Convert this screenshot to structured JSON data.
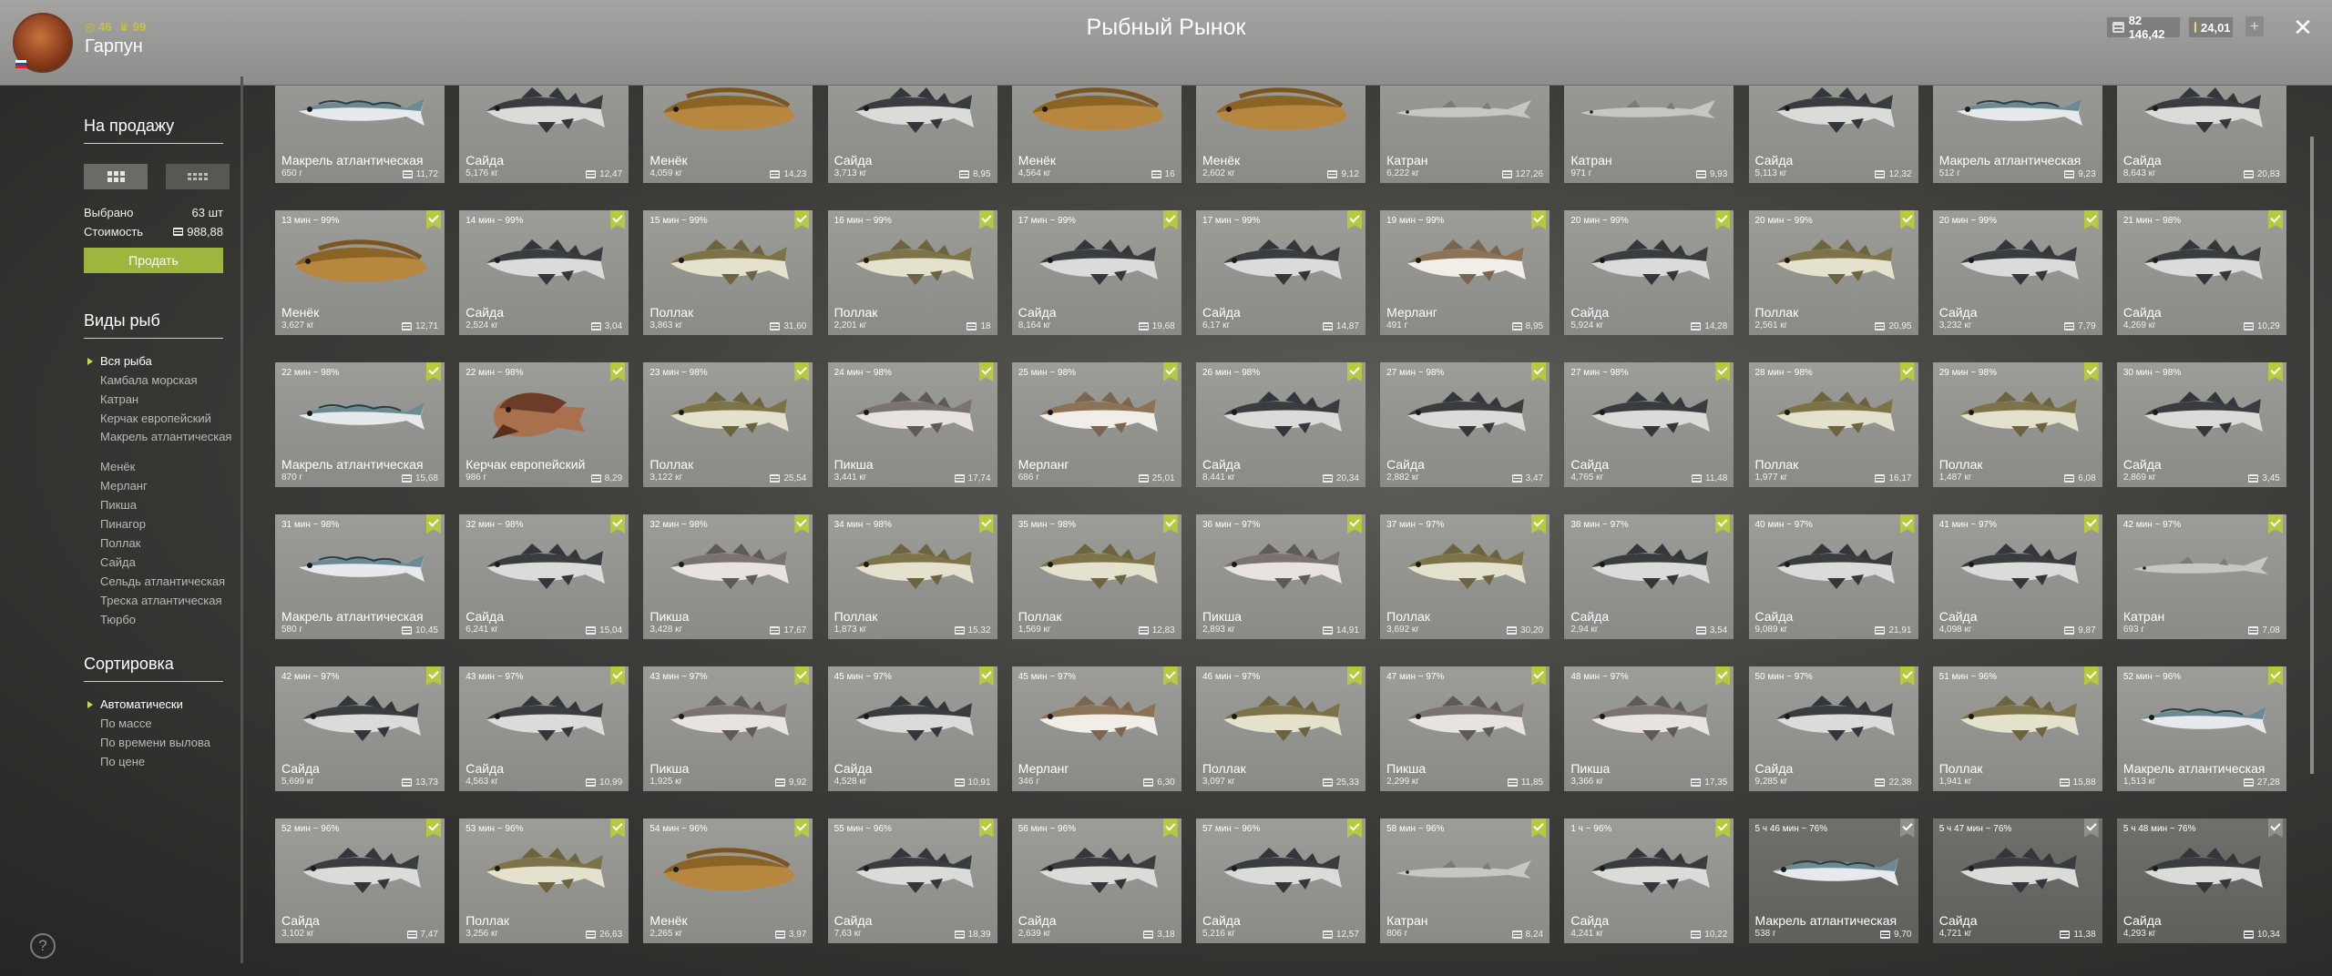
{
  "player": {
    "name": "Гарпун",
    "level": "46",
    "rating": "99"
  },
  "header": {
    "title": "Рыбный Рынок",
    "silver": "82 146,42",
    "gold": "24,01",
    "plus": "+",
    "close": "✕"
  },
  "sidebar": {
    "sale_title": "На продажу",
    "selected_label": "Выбрано",
    "selected_value": "63 шт",
    "cost_label": "Стоимость",
    "cost_value": "988,88",
    "sell_button": "Продать",
    "species_title": "Виды рыб",
    "species": [
      "Вся рыба",
      "Камбала морская",
      "Катран",
      "Керчак европейский",
      "Макрель атлантическая",
      "Менёк",
      "Мерланг",
      "Пикша",
      "Пинагор",
      "Поллак",
      "Сайда",
      "Сельдь атлантическая",
      "Треска атлантическая",
      "Тюрбо"
    ],
    "sort_title": "Сортировка",
    "sort_options": [
      "Автоматически",
      "По массе",
      "По времени вылова",
      "По цене"
    ],
    "help": "?"
  },
  "colors": {
    "accent": "#9eb63e",
    "check": "#b7c93e"
  },
  "fish": [
    {
      "time": "",
      "name": "Макрель атлантическая",
      "mass": "650 г",
      "price": "11,72",
      "kind": "mackerel"
    },
    {
      "time": "",
      "name": "Сайда",
      "mass": "5,176 кг",
      "price": "12,47",
      "kind": "saithe"
    },
    {
      "time": "",
      "name": "Менёк",
      "mass": "4,059 кг",
      "price": "14,23",
      "kind": "tusk"
    },
    {
      "time": "",
      "name": "Сайда",
      "mass": "3,713 кг",
      "price": "8,95",
      "kind": "saithe"
    },
    {
      "time": "",
      "name": "Менёк",
      "mass": "4,564 кг",
      "price": "16",
      "kind": "tusk"
    },
    {
      "time": "",
      "name": "Менёк",
      "mass": "2,602 кг",
      "price": "9,12",
      "kind": "tusk"
    },
    {
      "time": "",
      "name": "Катран",
      "mass": "6,222 кг",
      "price": "127,26",
      "kind": "shark"
    },
    {
      "time": "",
      "name": "Катран",
      "mass": "971 г",
      "price": "9,93",
      "kind": "shark"
    },
    {
      "time": "",
      "name": "Сайда",
      "mass": "5,113 кг",
      "price": "12,32",
      "kind": "saithe"
    },
    {
      "time": "",
      "name": "Макрель атлантическая",
      "mass": "512 г",
      "price": "9,23",
      "kind": "mackerel"
    },
    {
      "time": "",
      "name": "Сайда",
      "mass": "8,643 кг",
      "price": "20,83",
      "kind": "saithe"
    },
    {
      "time": "13 мин ~ 99%",
      "name": "Менёк",
      "mass": "3,627 кг",
      "price": "12,71",
      "kind": "tusk"
    },
    {
      "time": "14 мин ~ 99%",
      "name": "Сайда",
      "mass": "2,524 кг",
      "price": "3,04",
      "kind": "saithe"
    },
    {
      "time": "15 мин ~ 99%",
      "name": "Поллак",
      "mass": "3,863 кг",
      "price": "31,60",
      "kind": "pollack"
    },
    {
      "time": "16 мин ~ 99%",
      "name": "Поллак",
      "mass": "2,201 кг",
      "price": "18",
      "kind": "pollack"
    },
    {
      "time": "17 мин ~ 99%",
      "name": "Сайда",
      "mass": "8,164 кг",
      "price": "19,68",
      "kind": "saithe"
    },
    {
      "time": "17 мин ~ 99%",
      "name": "Сайда",
      "mass": "6,17 кг",
      "price": "14,87",
      "kind": "saithe"
    },
    {
      "time": "19 мин ~ 99%",
      "name": "Мерланг",
      "mass": "491 г",
      "price": "8,95",
      "kind": "whiting"
    },
    {
      "time": "20 мин ~ 99%",
      "name": "Сайда",
      "mass": "5,924 кг",
      "price": "14,28",
      "kind": "saithe"
    },
    {
      "time": "20 мин ~ 99%",
      "name": "Поллак",
      "mass": "2,561 кг",
      "price": "20,95",
      "kind": "pollack"
    },
    {
      "time": "20 мин ~ 99%",
      "name": "Сайда",
      "mass": "3,232 кг",
      "price": "7,79",
      "kind": "saithe"
    },
    {
      "time": "21 мин ~ 98%",
      "name": "Сайда",
      "mass": "4,269 кг",
      "price": "10,29",
      "kind": "saithe"
    },
    {
      "time": "22 мин ~ 98%",
      "name": "Макрель атлантическая",
      "mass": "870 г",
      "price": "15,68",
      "kind": "mackerel"
    },
    {
      "time": "22 мин ~ 98%",
      "name": "Керчак европейский",
      "mass": "986 г",
      "price": "8,29",
      "kind": "sculpin"
    },
    {
      "time": "23 мин ~ 98%",
      "name": "Поллак",
      "mass": "3,122 кг",
      "price": "25,54",
      "kind": "pollack"
    },
    {
      "time": "24 мин ~ 98%",
      "name": "Пикша",
      "mass": "3,441 кг",
      "price": "17,74",
      "kind": "haddock"
    },
    {
      "time": "25 мин ~ 98%",
      "name": "Мерланг",
      "mass": "686 г",
      "price": "25,01",
      "kind": "whiting"
    },
    {
      "time": "26 мин ~ 98%",
      "name": "Сайда",
      "mass": "8,441 кг",
      "price": "20,34",
      "kind": "saithe"
    },
    {
      "time": "27 мин ~ 98%",
      "name": "Сайда",
      "mass": "2,882 кг",
      "price": "3,47",
      "kind": "saithe"
    },
    {
      "time": "27 мин ~ 98%",
      "name": "Сайда",
      "mass": "4,765 кг",
      "price": "11,48",
      "kind": "saithe"
    },
    {
      "time": "28 мин ~ 98%",
      "name": "Поллак",
      "mass": "1,977 кг",
      "price": "16,17",
      "kind": "pollack"
    },
    {
      "time": "29 мин ~ 98%",
      "name": "Поллак",
      "mass": "1,487 кг",
      "price": "6,08",
      "kind": "pollack"
    },
    {
      "time": "30 мин ~ 98%",
      "name": "Сайда",
      "mass": "2,869 кг",
      "price": "3,45",
      "kind": "saithe"
    },
    {
      "time": "31 мин ~ 98%",
      "name": "Макрель атлантическая",
      "mass": "580 г",
      "price": "10,45",
      "kind": "mackerel"
    },
    {
      "time": "32 мин ~ 98%",
      "name": "Сайда",
      "mass": "6,241 кг",
      "price": "15,04",
      "kind": "saithe"
    },
    {
      "time": "32 мин ~ 98%",
      "name": "Пикша",
      "mass": "3,428 кг",
      "price": "17,67",
      "kind": "haddock"
    },
    {
      "time": "34 мин ~ 98%",
      "name": "Поллак",
      "mass": "1,873 кг",
      "price": "15,32",
      "kind": "pollack"
    },
    {
      "time": "35 мин ~ 98%",
      "name": "Поллак",
      "mass": "1,569 кг",
      "price": "12,83",
      "kind": "pollack"
    },
    {
      "time": "36 мин ~ 97%",
      "name": "Пикша",
      "mass": "2,893 кг",
      "price": "14,91",
      "kind": "haddock"
    },
    {
      "time": "37 мин ~ 97%",
      "name": "Поллак",
      "mass": "3,692 кг",
      "price": "30,20",
      "kind": "pollack"
    },
    {
      "time": "38 мин ~ 97%",
      "name": "Сайда",
      "mass": "2,94 кг",
      "price": "3,54",
      "kind": "saithe"
    },
    {
      "time": "40 мин ~ 97%",
      "name": "Сайда",
      "mass": "9,089 кг",
      "price": "21,91",
      "kind": "saithe"
    },
    {
      "time": "41 мин ~ 97%",
      "name": "Сайда",
      "mass": "4,098 кг",
      "price": "9,87",
      "kind": "saithe"
    },
    {
      "time": "42 мин ~ 97%",
      "name": "Катран",
      "mass": "693 г",
      "price": "7,08",
      "kind": "shark"
    },
    {
      "time": "42 мин ~ 97%",
      "name": "Сайда",
      "mass": "5,699 кг",
      "price": "13,73",
      "kind": "saithe"
    },
    {
      "time": "43 мин ~ 97%",
      "name": "Сайда",
      "mass": "4,563 кг",
      "price": "10,99",
      "kind": "saithe"
    },
    {
      "time": "43 мин ~ 97%",
      "name": "Пикша",
      "mass": "1,925 кг",
      "price": "9,92",
      "kind": "haddock"
    },
    {
      "time": "45 мин ~ 97%",
      "name": "Сайда",
      "mass": "4,528 кг",
      "price": "10,91",
      "kind": "saithe"
    },
    {
      "time": "45 мин ~ 97%",
      "name": "Мерланг",
      "mass": "346 г",
      "price": "6,30",
      "kind": "whiting"
    },
    {
      "time": "46 мин ~ 97%",
      "name": "Поллак",
      "mass": "3,097 кг",
      "price": "25,33",
      "kind": "pollack"
    },
    {
      "time": "47 мин ~ 97%",
      "name": "Пикша",
      "mass": "2,299 кг",
      "price": "11,85",
      "kind": "haddock"
    },
    {
      "time": "48 мин ~ 97%",
      "name": "Пикша",
      "mass": "3,366 кг",
      "price": "17,35",
      "kind": "haddock"
    },
    {
      "time": "50 мин ~ 97%",
      "name": "Сайда",
      "mass": "9,285 кг",
      "price": "22,38",
      "kind": "saithe"
    },
    {
      "time": "51 мин ~ 96%",
      "name": "Поллак",
      "mass": "1,941 кг",
      "price": "15,88",
      "kind": "pollack"
    },
    {
      "time": "52 мин ~ 96%",
      "name": "Макрель атлантическая",
      "mass": "1,513 кг",
      "price": "27,28",
      "kind": "mackerel"
    },
    {
      "time": "52 мин ~ 96%",
      "name": "Сайда",
      "mass": "3,102 кг",
      "price": "7,47",
      "kind": "saithe"
    },
    {
      "time": "53 мин ~ 96%",
      "name": "Поллак",
      "mass": "3,256 кг",
      "price": "26,63",
      "kind": "pollack"
    },
    {
      "time": "54 мин ~ 96%",
      "name": "Менёк",
      "mass": "2,265 кг",
      "price": "3,97",
      "kind": "tusk"
    },
    {
      "time": "55 мин ~ 96%",
      "name": "Сайда",
      "mass": "7,63 кг",
      "price": "18,39",
      "kind": "saithe"
    },
    {
      "time": "56 мин ~ 96%",
      "name": "Сайда",
      "mass": "2,639 кг",
      "price": "3,18",
      "kind": "saithe"
    },
    {
      "time": "57 мин ~ 96%",
      "name": "Сайда",
      "mass": "5,216 кг",
      "price": "12,57",
      "kind": "saithe"
    },
    {
      "time": "58 мин ~ 96%",
      "name": "Катран",
      "mass": "806 г",
      "price": "8,24",
      "kind": "shark"
    },
    {
      "time": "1 ч ~ 96%",
      "name": "Сайда",
      "mass": "4,241 кг",
      "price": "10,22",
      "kind": "saithe"
    },
    {
      "time": "5 ч 46 мин ~ 76%",
      "name": "Макрель атлантическая",
      "mass": "538 г",
      "price": "9,70",
      "kind": "mackerel",
      "dark": true
    },
    {
      "time": "5 ч 47 мин ~ 76%",
      "name": "Сайда",
      "mass": "4,721 кг",
      "price": "11,38",
      "kind": "saithe",
      "dark": true
    },
    {
      "time": "5 ч 48 мин ~ 76%",
      "name": "Сайда",
      "mass": "4,293 кг",
      "price": "10,34",
      "kind": "saithe",
      "dark": true
    }
  ]
}
